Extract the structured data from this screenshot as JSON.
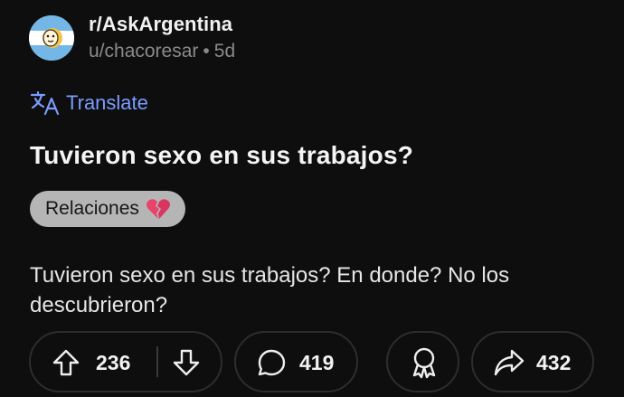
{
  "post": {
    "subreddit": "r/AskArgentina",
    "author": "u/chacoresar",
    "separator": "•",
    "age": "5d",
    "translate_label": "Translate",
    "title": "Tuvieron sexo en sus trabajos?",
    "flair": {
      "label": "Relaciones",
      "emoji_icon": "broken-heart-icon"
    },
    "body": "Tuvieron sexo en sus trabajos? En donde? No los descubrieron?"
  },
  "actions": {
    "upvotes": "236",
    "comments": "419",
    "shares": "432"
  },
  "colors": {
    "background": "#0e0e0e",
    "translate_link": "#7a9cff",
    "flair_bg": "#b5b5b5",
    "muted_text": "#8a8a8a",
    "pill_border": "#2d2d2d"
  }
}
